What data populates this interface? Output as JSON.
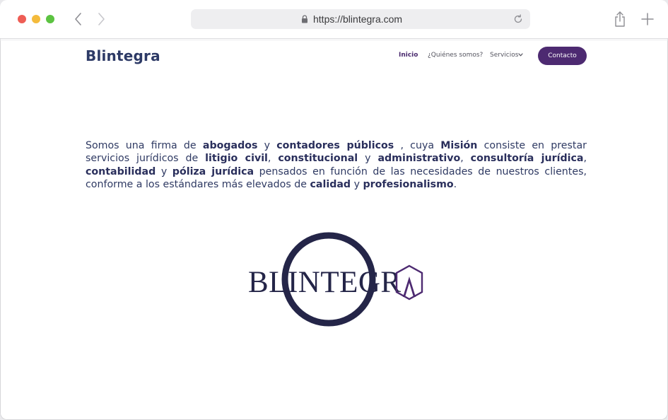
{
  "browser": {
    "url": "https://blintegra.com"
  },
  "site": {
    "brand": "Blintegra",
    "nav": {
      "inicio": "Inicio",
      "quienes": "¿Quiénes somos?",
      "servicios": "Servicios",
      "contact_button": "Contacto"
    },
    "mission": [
      {
        "text": "Somos una firma de ",
        "bold": false
      },
      {
        "text": "abogados",
        "bold": true
      },
      {
        "text": " y ",
        "bold": false
      },
      {
        "text": "contadores públicos",
        "bold": true
      },
      {
        "text": " , cuya ",
        "bold": false
      },
      {
        "text": "Misión",
        "bold": true
      },
      {
        "text": " consiste en prestar servicios jurídicos de ",
        "bold": false
      },
      {
        "text": "litigio civil",
        "bold": true
      },
      {
        "text": ", ",
        "bold": false
      },
      {
        "text": "constitucional",
        "bold": true
      },
      {
        "text": " y ",
        "bold": false
      },
      {
        "text": "administrativo",
        "bold": true
      },
      {
        "text": ", ",
        "bold": false
      },
      {
        "text": "consultoría jurídica",
        "bold": true
      },
      {
        "text": ", ",
        "bold": false
      },
      {
        "text": "contabilidad",
        "bold": true
      },
      {
        "text": " y ",
        "bold": false
      },
      {
        "text": "póliza jurídica",
        "bold": true
      },
      {
        "text": " pensados en función de las necesidades de nuestros clientes, conforme a los estándares más elevados de ",
        "bold": false
      },
      {
        "text": "calidad",
        "bold": true
      },
      {
        "text": " y ",
        "bold": false
      },
      {
        "text": "profesionalismo",
        "bold": true
      },
      {
        "text": ".",
        "bold": false
      }
    ],
    "logo_text": "BLINTEGR"
  },
  "colors": {
    "brand_navy": "#2d3a66",
    "brand_purple": "#4d2a71",
    "logo_navy": "#242548"
  },
  "icons": {
    "back": "chevron-left-icon",
    "forward": "chevron-right-icon",
    "lock": "lock-icon",
    "reload": "reload-icon",
    "share": "share-icon",
    "new_tab": "plus-icon"
  }
}
